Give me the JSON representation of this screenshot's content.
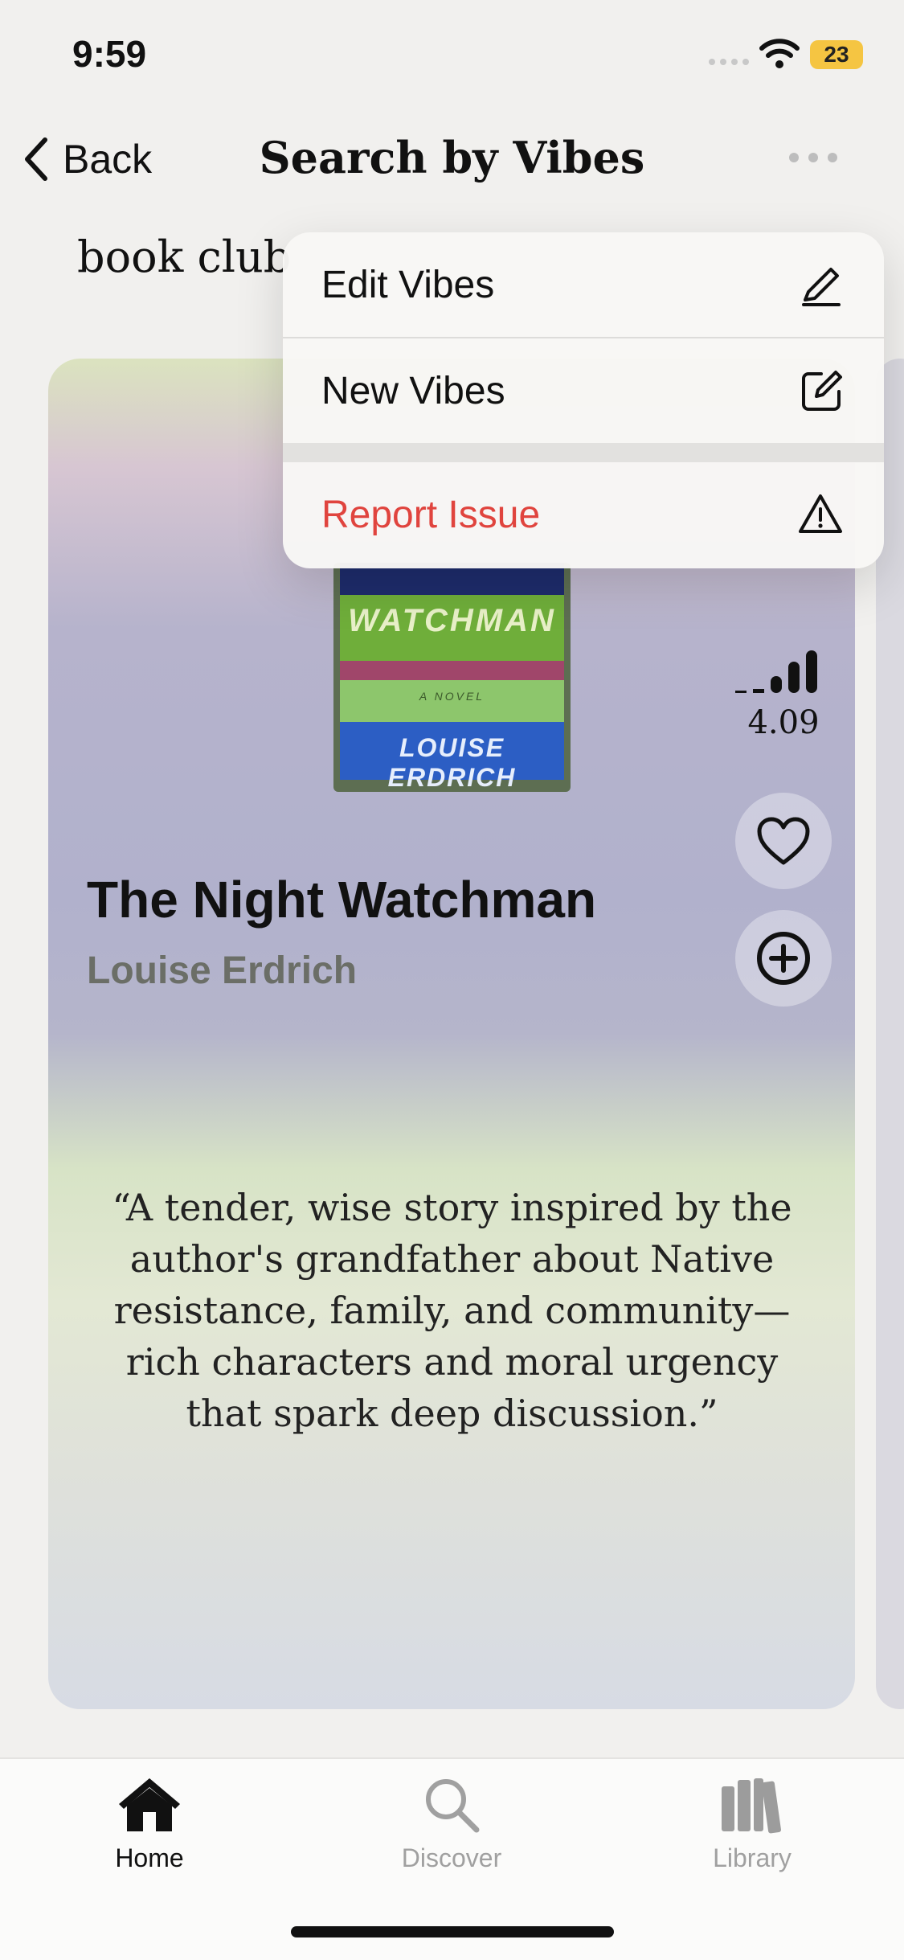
{
  "status_bar": {
    "time": "9:59",
    "battery": "23"
  },
  "nav": {
    "back_label": "Back",
    "title": "Search by Vibes"
  },
  "query": "book club",
  "menu": {
    "items": [
      {
        "label": "Edit Vibes",
        "icon": "pencil-icon"
      },
      {
        "label": "New Vibes",
        "icon": "compose-icon"
      },
      {
        "label": "Report Issue",
        "icon": "warning-icon",
        "color": "#e0443e"
      }
    ]
  },
  "book": {
    "cover": {
      "line1": "WATCHMAN",
      "line2": "A NOVEL",
      "line3": "LOUISE ERDRICH"
    },
    "title": "The Night Watchman",
    "author": "Louise Erdrich",
    "rating": "4.09",
    "quote": "“A tender, wise story inspired by the author's grandfather about Native resistance, family, and community—rich characters and moral urgency that spark deep discussion.”"
  },
  "tabs": [
    {
      "label": "Home",
      "icon": "home-icon",
      "active": true
    },
    {
      "label": "Discover",
      "icon": "magnifier-icon",
      "active": false
    },
    {
      "label": "Library",
      "icon": "books-icon",
      "active": false
    }
  ]
}
